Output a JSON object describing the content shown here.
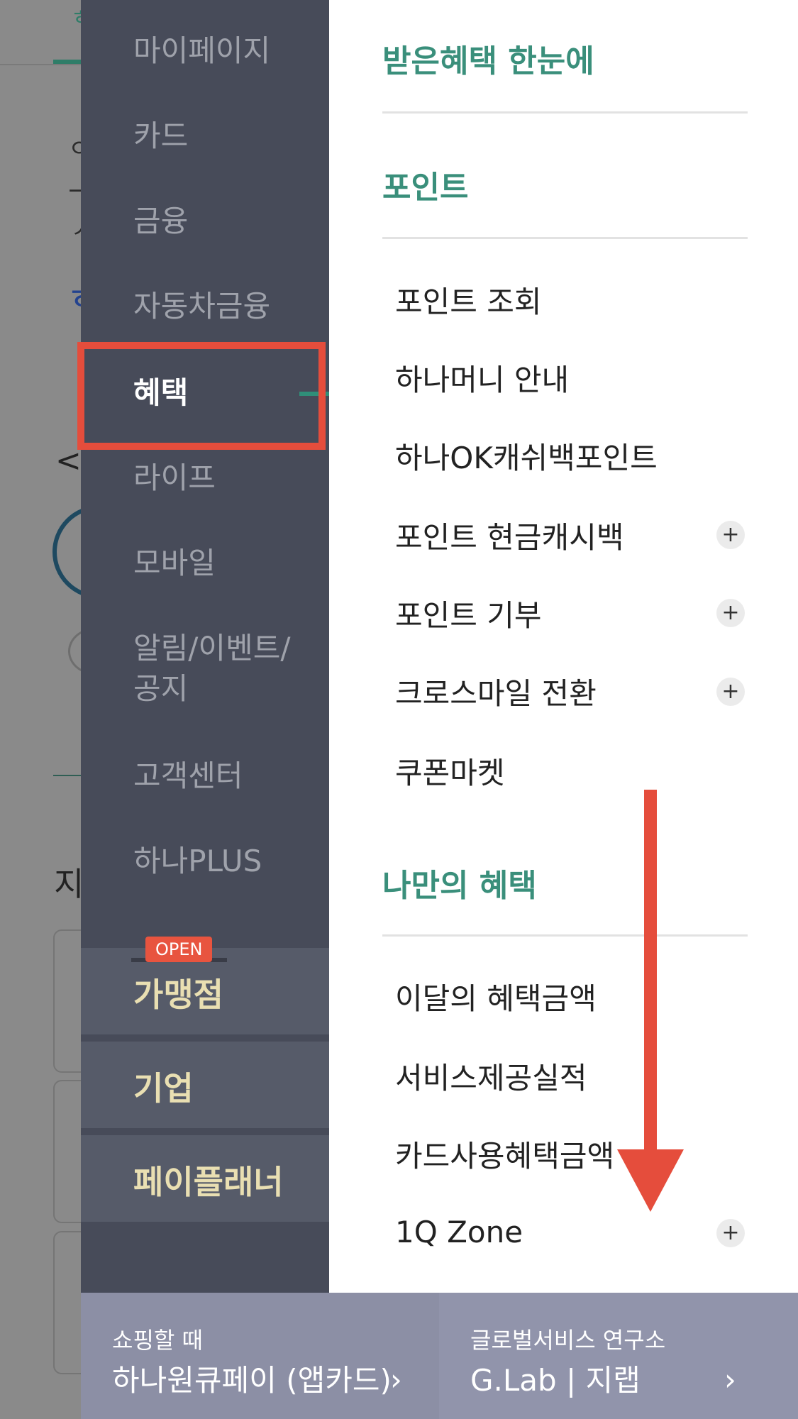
{
  "nav": {
    "items": [
      {
        "label": "마이페이지"
      },
      {
        "label": "카드"
      },
      {
        "label": "금융"
      },
      {
        "label": "자동차금융"
      },
      {
        "label": "혜택"
      },
      {
        "label": "라이프"
      },
      {
        "label": "모바일"
      },
      {
        "label": "알림/이벤트/공지"
      },
      {
        "label": "고객센터"
      },
      {
        "label": "하나PLUS"
      }
    ],
    "blocks": [
      {
        "label": "가맹점",
        "badge": "OPEN"
      },
      {
        "label": "기업"
      },
      {
        "label": "페이플래너"
      }
    ]
  },
  "panel": {
    "header_link": "받은혜택 한눈에",
    "sections": [
      {
        "title": "포인트",
        "items": [
          {
            "label": "포인트 조회"
          },
          {
            "label": "하나머니 안내"
          },
          {
            "label": "하나OK캐쉬백포인트"
          },
          {
            "label": "포인트 현금캐시백",
            "expand": "+"
          },
          {
            "label": "포인트 기부",
            "expand": "+"
          },
          {
            "label": "크로스마일 전환",
            "expand": "+"
          },
          {
            "label": "쿠폰마켓"
          }
        ]
      },
      {
        "title": "나만의 혜택",
        "items": [
          {
            "label": "이달의 혜택금액"
          },
          {
            "label": "서비스제공실적"
          },
          {
            "label": "카드사용혜택금액"
          },
          {
            "label": "1Q Zone",
            "expand": "+"
          }
        ]
      }
    ]
  },
  "promo": {
    "left": {
      "sub": "쇼핑할 때",
      "main": "하나원큐페이 (앱카드)",
      "chevron": "›"
    },
    "right": {
      "sub": "글로벌서비스 연구소",
      "main": "G.Lab | 지랩",
      "chevron": "›"
    }
  },
  "background": {
    "chevron": "<",
    "fragments": [
      "ㅎ",
      "ㅇ",
      "ㅡ",
      "ㅅ",
      "ㅎ",
      "지"
    ]
  },
  "colors": {
    "nav_bg": "#474b59",
    "accent_green": "#3a8f7b",
    "highlight_red": "#e54d3c",
    "block_text": "#e9dfb2"
  }
}
